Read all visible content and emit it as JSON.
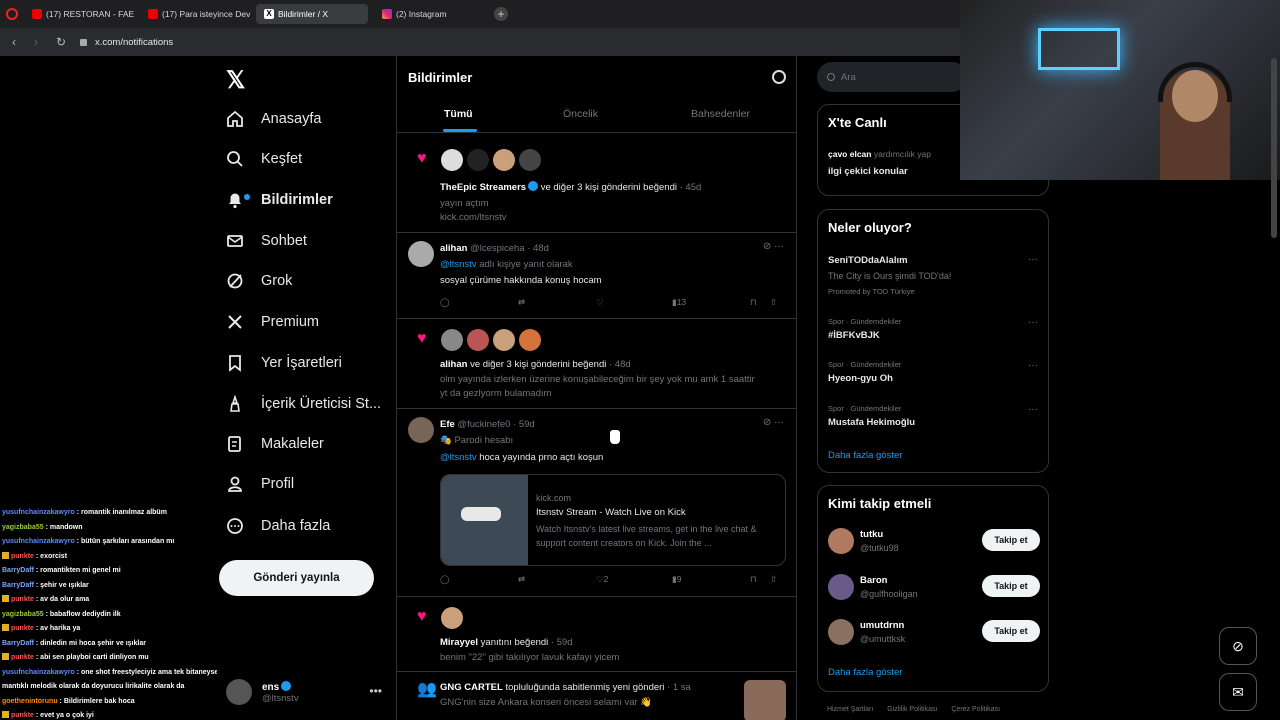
{
  "browser": {
    "tabs": [
      {
        "label": "(17) RESTORAN - FAENA",
        "icon": "youtube-icon",
        "active": false
      },
      {
        "label": "(17) Para isteyince Devrek",
        "icon": "youtube-icon",
        "active": false
      },
      {
        "label": "Bildirimler / X",
        "icon": "x-icon",
        "active": true
      },
      {
        "label": "(2) Instagram",
        "icon": "instagram-icon",
        "active": false
      }
    ],
    "url": "x.com/notifications"
  },
  "nav": {
    "items": [
      {
        "label": "Anasayfa",
        "icon": "home-icon"
      },
      {
        "label": "Keşfet",
        "icon": "search-icon"
      },
      {
        "label": "Bildirimler",
        "icon": "bell-icon"
      },
      {
        "label": "Sohbet",
        "icon": "mail-icon"
      },
      {
        "label": "Grok",
        "icon": "grok-icon"
      },
      {
        "label": "Premium",
        "icon": "x-icon"
      },
      {
        "label": "Yer İşaretleri",
        "icon": "bookmark-icon"
      },
      {
        "label": "İçerik Üreticisi St...",
        "icon": "creator-icon"
      },
      {
        "label": "Makaleler",
        "icon": "article-icon"
      },
      {
        "label": "Profil",
        "icon": "person-icon"
      },
      {
        "label": "Daha fazla",
        "icon": "more-icon"
      }
    ],
    "post_button": "Gönderi yayınla",
    "account": {
      "name": "ens",
      "handle": "@ltsnstv"
    }
  },
  "chat": [
    {
      "user": "yusufnchainzakawyro",
      "msg": " : romantik inanılmaz albüm",
      "color": "#5b8cff",
      "badge": false
    },
    {
      "user": "yagizbaba55",
      "msg": " : mandown",
      "color": "#9acd32",
      "badge": false
    },
    {
      "user": "yusufnchainzakawyro",
      "msg": " : bütün şarkıları arasından mı",
      "color": "#5b8cff",
      "badge": false
    },
    {
      "user": "punkte",
      "msg": " : exorcist",
      "color": "#ff5050",
      "badge": true
    },
    {
      "user": "BarryDaff",
      "msg": " : romantikten mi genel mi",
      "color": "#7aa7ff",
      "badge": false
    },
    {
      "user": "BarryDaff",
      "msg": " : şehir ve ışıklar",
      "color": "#7aa7ff",
      "badge": false
    },
    {
      "user": "punkte",
      "msg": " : av da olur ama",
      "color": "#ff5050",
      "badge": true
    },
    {
      "user": "yagizbaba55",
      "msg": " : babaflow dediydin ilk",
      "color": "#9acd32",
      "badge": false
    },
    {
      "user": "punkte",
      "msg": " : av harika ya",
      "color": "#ff5050",
      "badge": true
    },
    {
      "user": "BarryDaff",
      "msg": " : dinledin mi hoca şehir ve ışıklar",
      "color": "#7aa7ff",
      "badge": false
    },
    {
      "user": "punkte",
      "msg": " : abi sen playboi carti dinliyon mu",
      "color": "#ff5050",
      "badge": true
    },
    {
      "user": "yusufnchainzakawyro",
      "msg": " : one shot freestyleciyiz ama tek bitaneyse exorcist çok",
      "color": "#5b8cff",
      "badge": false
    },
    {
      "user": "",
      "msg": "mantıklı melodik olarak da doyurucu lirikalite olarak da",
      "color": "#fff",
      "badge": false
    },
    {
      "user": "goethenintorunu",
      "msg": " : Bildirimlere bak hoca",
      "color": "#ff8c00",
      "badge": false
    },
    {
      "user": "punkte",
      "msg": " : evet ya o çok iyi",
      "color": "#ff5050",
      "badge": true
    }
  ],
  "main": {
    "title": "Bildirimler",
    "tabs": [
      "Tümü",
      "Öncelik",
      "Bahsedenler"
    ],
    "notifications": [
      {
        "name": "TheEpic Streamers",
        "text": " ve diğer 3 kişi gönderini beğendi",
        "time": " · 45d",
        "body1": "yayın açtım",
        "body2": "kick.com/ltsnstv"
      },
      {
        "name": "alihan",
        "handle": " @lcespiceha",
        "time": " · 48d",
        "reply_to": "@ltsnstv",
        "reply_suffix": " adlı kişiye yanıt olarak",
        "body": "sosyal çürüme hakkında konuş hocam",
        "views": "13"
      },
      {
        "name": "alihan",
        "text": " ve diğer 3 kişi gönderini beğendi",
        "time": " · 48d",
        "body1": "olm yayında izlerken üzerine konuşabileceğim bir şey yok mu amk 1 saattir",
        "body2": "yt da gezlyorm bulamadım"
      },
      {
        "name": "Efe",
        "handle": " @fuckinefe0",
        "time": " · 59d",
        "label": "Parodi hesabı",
        "mention": "@ltsnstv",
        "body": " hoca yayında prno açtı koşun",
        "card_domain": "kick.com",
        "card_title": "Itsnstv Stream - Watch Live on Kick",
        "card_desc": "Watch Itsnstv's latest live streams, get in the live chat & support content creators on Kick. Join the ...",
        "likes": "2",
        "views": "9"
      },
      {
        "name": "Mirayyel",
        "text": " yanıtını beğendi",
        "time": " · 59d",
        "body": "benim \"22\" gibi takılıyor lavuk kafayı yicem"
      },
      {
        "name": "GNG CARTEL",
        "text": " topluluğunda sabitlenmiş yeni gönderi",
        "time": " · 1 sa",
        "body": "GNG'nin size Ankara konseri öncesi selamı var 👋"
      }
    ]
  },
  "right": {
    "search_placeholder": "Ara",
    "live": {
      "title": "X'te Canlı",
      "host": "çavo elcan",
      "host_suffix": " yardımcılık yap",
      "topic": "ilgi çekici konular"
    },
    "trends_title": "Neler oluyor?",
    "promo": {
      "name": "SeniTODdaAlalım",
      "desc": "The City is Ours şimdi TOD'da!",
      "promoted": "Promoted by TOD Türkiye"
    },
    "trends": [
      {
        "cat": "Spor · Gündemdekiler",
        "name": "#İBFKvBJK"
      },
      {
        "cat": "Spor · Gündemdekiler",
        "name": "Hyeon-gyu Oh"
      },
      {
        "cat": "Spor · Gündemdekiler",
        "name": "Mustafa Hekimoğlu"
      }
    ],
    "show_more": "Daha fazla göster",
    "who_title": "Kimi takip etmeli",
    "who": [
      {
        "name": "tutku",
        "handle": "@tutku98",
        "button": "Takip et"
      },
      {
        "name": "Baron",
        "handle": "@gulfhooligan",
        "button": "Takip et"
      },
      {
        "name": "umutdrnn",
        "handle": "@umuttksk",
        "button": "Takip et"
      }
    ],
    "footer": [
      "Hizmet Şartları",
      "Gizlilik Politikası",
      "Çerez Politikası"
    ]
  },
  "colors": {
    "accent": "#1d9bf0",
    "like": "#f91880",
    "background": "#000000"
  }
}
